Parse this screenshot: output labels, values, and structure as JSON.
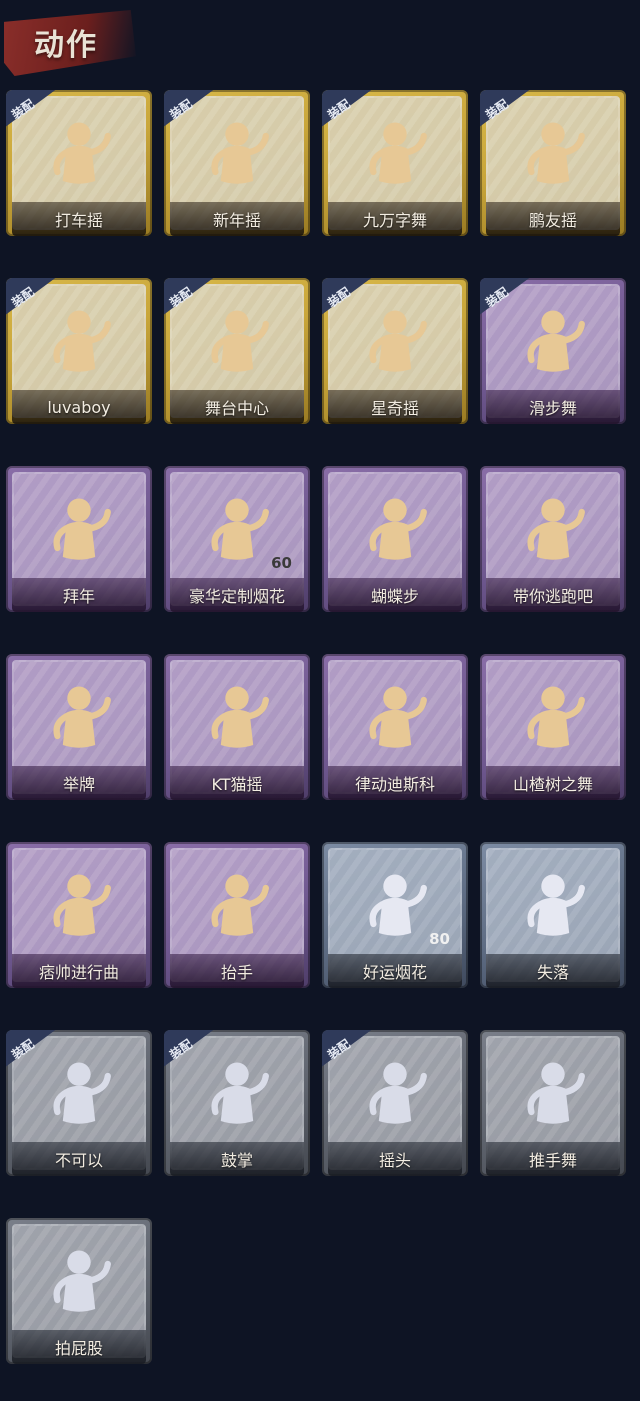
{
  "header": {
    "title": "动作"
  },
  "equip_badge": "装配",
  "items": [
    {
      "label": "打车摇",
      "tier": "gold",
      "equipped": true,
      "count": ""
    },
    {
      "label": "新年摇",
      "tier": "gold",
      "equipped": true,
      "count": ""
    },
    {
      "label": "九万字舞",
      "tier": "gold",
      "equipped": true,
      "count": ""
    },
    {
      "label": "鹏友摇",
      "tier": "gold",
      "equipped": true,
      "count": ""
    },
    {
      "label": "luvaboy",
      "tier": "gold",
      "equipped": true,
      "count": ""
    },
    {
      "label": "舞台中心",
      "tier": "gold",
      "equipped": true,
      "count": ""
    },
    {
      "label": "星奇摇",
      "tier": "gold",
      "equipped": true,
      "count": ""
    },
    {
      "label": "滑步舞",
      "tier": "purple",
      "equipped": true,
      "count": ""
    },
    {
      "label": "拜年",
      "tier": "purple",
      "equipped": false,
      "count": ""
    },
    {
      "label": "豪华定制烟花",
      "tier": "purple",
      "equipped": false,
      "count": "60"
    },
    {
      "label": "蝴蝶步",
      "tier": "purple",
      "equipped": false,
      "count": ""
    },
    {
      "label": "带你逃跑吧",
      "tier": "purple",
      "equipped": false,
      "count": ""
    },
    {
      "label": "举牌",
      "tier": "purple",
      "equipped": false,
      "count": ""
    },
    {
      "label": "KT猫摇",
      "tier": "purple",
      "equipped": false,
      "count": ""
    },
    {
      "label": "律动迪斯科",
      "tier": "purple",
      "equipped": false,
      "count": ""
    },
    {
      "label": "山楂树之舞",
      "tier": "purple",
      "equipped": false,
      "count": ""
    },
    {
      "label": "痞帅进行曲",
      "tier": "purple",
      "equipped": false,
      "count": ""
    },
    {
      "label": "抬手",
      "tier": "purple",
      "equipped": false,
      "count": ""
    },
    {
      "label": "好运烟花",
      "tier": "blue",
      "equipped": false,
      "count": "80"
    },
    {
      "label": "失落",
      "tier": "blue",
      "equipped": false,
      "count": ""
    },
    {
      "label": "不可以",
      "tier": "gray",
      "equipped": true,
      "count": ""
    },
    {
      "label": "鼓掌",
      "tier": "gray",
      "equipped": true,
      "count": ""
    },
    {
      "label": "摇头",
      "tier": "gray",
      "equipped": true,
      "count": ""
    },
    {
      "label": "推手舞",
      "tier": "gray",
      "equipped": false,
      "count": ""
    },
    {
      "label": "拍屁股",
      "tier": "gray",
      "equipped": false,
      "count": ""
    }
  ],
  "colors": {
    "background": "#0e1424",
    "gold": "#c9a63a",
    "purple": "#6f5890",
    "blue": "#5d6b82",
    "gray": "#5e636d",
    "badge": "#2f3a5a"
  }
}
